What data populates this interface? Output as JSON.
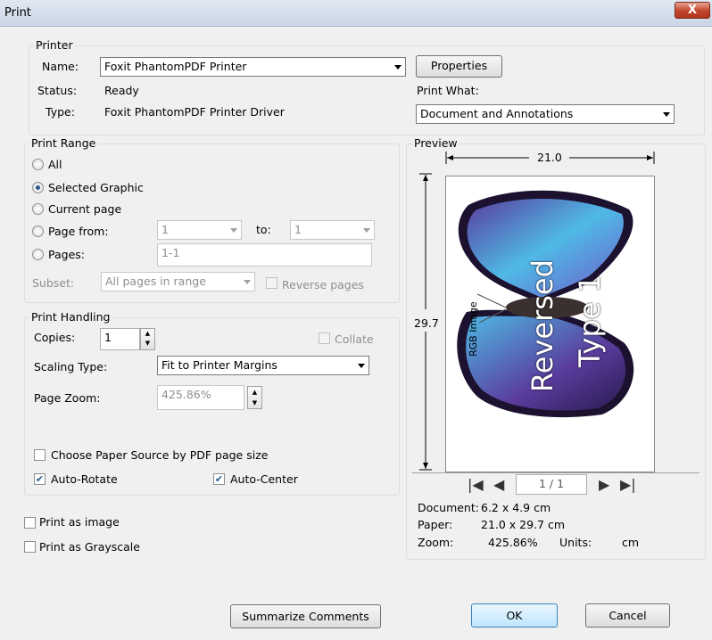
{
  "window": {
    "title": "Print",
    "close_label": "X"
  },
  "printer": {
    "legend": "Printer",
    "name_label": "Name:",
    "name_value": "Foxit PhantomPDF Printer",
    "status_label": "Status:",
    "status_value": "Ready",
    "type_label": "Type:",
    "type_value": "Foxit PhantomPDF Printer Driver",
    "properties_button": "Properties",
    "print_what_label": "Print What:",
    "print_what_value": "Document and Annotations"
  },
  "print_range": {
    "legend": "Print Range",
    "all_label": "All",
    "selected_graphic_label": "Selected Graphic",
    "current_page_label": "Current page",
    "page_from_label": "Page from:",
    "page_from_value": "1",
    "to_label": "to:",
    "to_value": "1",
    "pages_label": "Pages:",
    "pages_value": "1-1",
    "subset_label": "Subset:",
    "subset_value": "All pages in range",
    "reverse_pages_label": "Reverse pages",
    "selected_option": "Selected Graphic"
  },
  "print_handling": {
    "legend": "Print Handling",
    "copies_label": "Copies:",
    "copies_value": "1",
    "collate_label": "Collate",
    "scaling_type_label": "Scaling Type:",
    "scaling_type_value": "Fit to Printer Margins",
    "page_zoom_label": "Page Zoom:",
    "page_zoom_value": "425.86%",
    "choose_paper_label": "Choose Paper Source by PDF page size",
    "choose_paper_checked": false,
    "auto_rotate_label": "Auto-Rotate",
    "auto_rotate_checked": true,
    "auto_center_label": "Auto-Center",
    "auto_center_checked": true
  },
  "options": {
    "print_as_image_label": "Print as image",
    "print_as_image_checked": false,
    "print_as_grayscale_label": "Print as Grayscale",
    "print_as_grayscale_checked": false
  },
  "preview": {
    "legend": "Preview",
    "width_dim": "21.0",
    "height_dim": "29.7",
    "rgb_label": "RGB Image",
    "overlay_line1": "Reversed",
    "overlay_line2": "Type 1",
    "page_indicator": "1 / 1",
    "document_label": "Document:",
    "document_value": "6.2 x 4.9 cm",
    "paper_label": "Paper:",
    "paper_value": "21.0 x 29.7 cm",
    "zoom_label": "Zoom:",
    "zoom_value": "425.86%",
    "units_label": "Units:",
    "units_value": "cm"
  },
  "footer": {
    "summarize_button": "Summarize Comments",
    "ok_button": "OK",
    "cancel_button": "Cancel"
  },
  "colors": {
    "butterfly_blue": "#4fb9e6",
    "butterfly_purple": "#5a3b9c",
    "butterfly_dark": "#1c1230",
    "accent": "#3c7fb1"
  }
}
